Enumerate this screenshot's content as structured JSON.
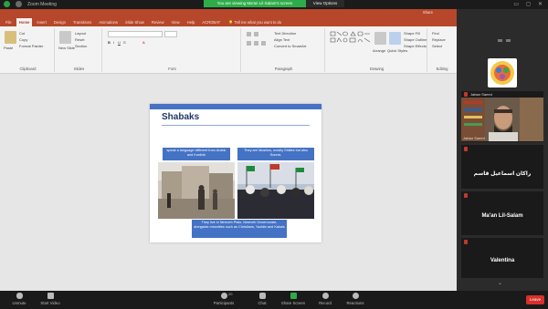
{
  "zoom": {
    "window_title": "Zoom Meeting",
    "banner": "You are viewing Ma'an Lil-Salam's screen",
    "view_options": "View Options"
  },
  "ppt": {
    "tabs": [
      "File",
      "Home",
      "Insert",
      "Design",
      "Transitions",
      "Animations",
      "Slide Show",
      "Review",
      "View",
      "Help",
      "ACROBAT"
    ],
    "search": "Tell me what you want to do",
    "share": "Share",
    "ribbon_groups": [
      "Clipboard",
      "Slides",
      "Font",
      "Paragraph",
      "Drawing",
      "Editing"
    ],
    "ribbon": {
      "paste": "Paste",
      "cut": "Cut",
      "copy": "Copy",
      "format_painter": "Format Painter",
      "new_slide": "New Slide",
      "layout": "Layout",
      "reset": "Reset",
      "section": "Section",
      "arrange": "Arrange",
      "quick_styles": "Quick Styles",
      "shape_fill": "Shape Fill",
      "shape_outline": "Shape Outline",
      "shape_effects": "Shape Effects",
      "find": "Find",
      "replace": "Replace",
      "select": "Select",
      "text_direction": "Text Direction",
      "align_text": "Align Text",
      "convert_smartart": "Convert to SmartArt"
    }
  },
  "slide": {
    "title": "Shabaks",
    "cap1": "speak a language different from Arabic and Kurdish",
    "cap2": "They are Muslims, mostly Shiites but also Sunnis.",
    "cap3": "They live in Nineveh Plain, Nineveh Governorate, alongside minorities such as Christians, Yazidis and Kakais"
  },
  "participants": [
    {
      "name": "Jafaar Saeed",
      "label": "Jafaar Saeed"
    },
    {
      "name": "راكان اسماعيل قاسم"
    },
    {
      "name": "Ma'an Lil-Salam"
    },
    {
      "name": "Valentina"
    }
  ],
  "toolbar": {
    "unmute": "Unmute",
    "start_video": "Start Video",
    "participants": "Participants",
    "participants_count": "20",
    "chat": "Chat",
    "share_screen": "Share Screen",
    "record": "Record",
    "reactions": "Reactions",
    "leave": "Leave"
  },
  "colors": {
    "ppt_accent": "#b7472a",
    "slide_accent": "#4472c4",
    "zoom_green": "#2eac4a",
    "leave_red": "#d9302b"
  }
}
